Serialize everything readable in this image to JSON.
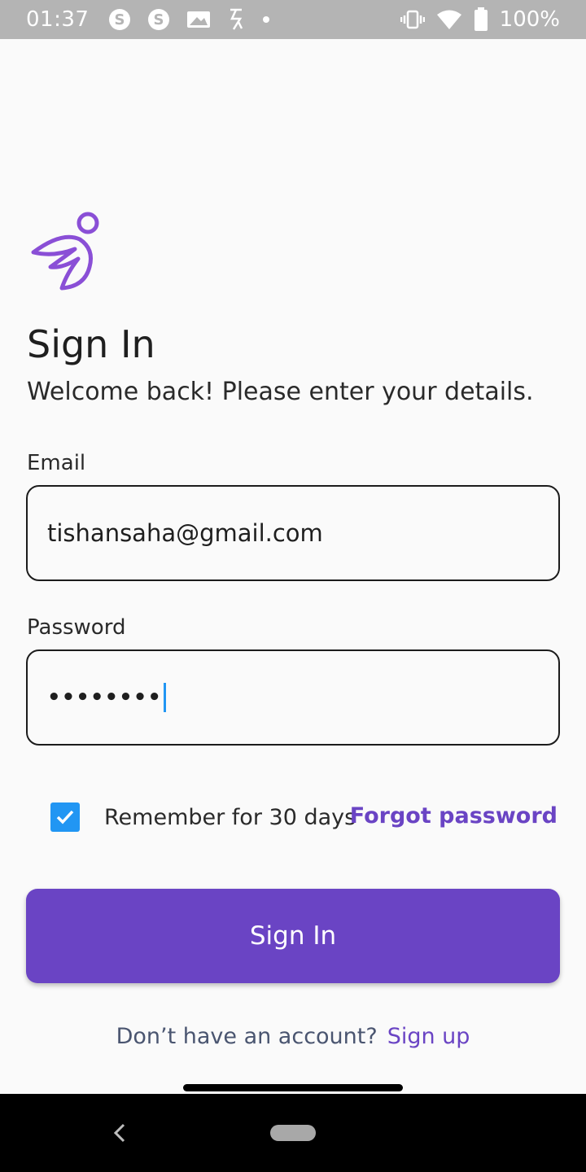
{
  "status_bar": {
    "time": "01:37",
    "battery_percent": "100%",
    "left_icons": [
      "skype-icon",
      "skype-icon",
      "image-icon",
      "signal-app-icon",
      "dot-icon"
    ],
    "right_icons": [
      "vibrate-icon",
      "wifi-icon",
      "battery-icon"
    ]
  },
  "header": {
    "title": "Sign In",
    "subtitle": "Welcome back! Please enter your details."
  },
  "form": {
    "email_label": "Email",
    "email_value": "tishansaha@gmail.com",
    "password_label": "Password",
    "password_value": "••••••••",
    "remember_label": "Remember for 30 days",
    "remember_checked": true,
    "forgot_label": "Forgot password"
  },
  "actions": {
    "signin_label": "Sign In",
    "signup_prompt": "Don’t have an account?",
    "signup_label": "Sign up"
  },
  "colors": {
    "accent": "#6a44c4",
    "checkbox": "#2196f3",
    "status_bar": "#b4b4b4"
  }
}
